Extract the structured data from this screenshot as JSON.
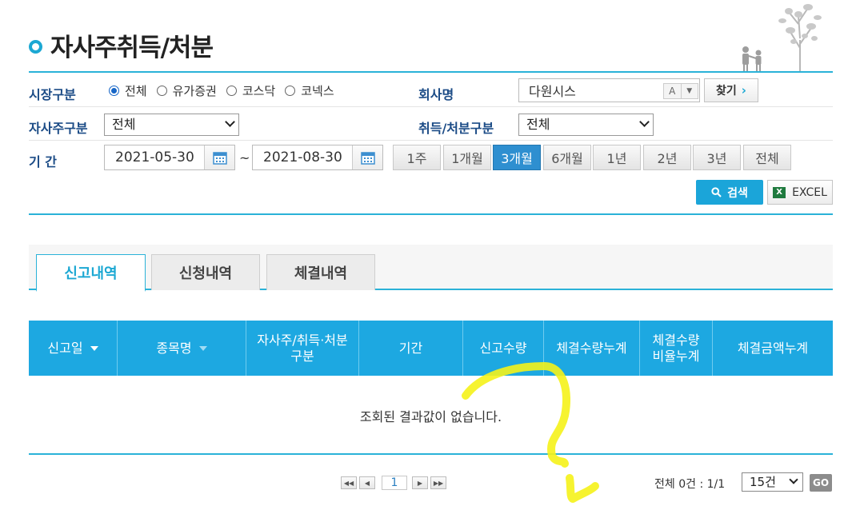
{
  "page": {
    "title": "자사주취득/처분"
  },
  "form": {
    "market_label": "시장구분",
    "market_options": [
      "전체",
      "유가증권",
      "코스닥",
      "코넥스"
    ],
    "market_selected": "전체",
    "company_label": "회사명",
    "company_value": "다원시스",
    "company_a_label": "A",
    "company_arrow": "▼",
    "find_label": "찾기",
    "treasury_label": "자사주구분",
    "treasury_value": "전체",
    "acq_label": "취득/처분구분",
    "acq_value": "전체",
    "period_label": "기 간",
    "date_from": "2021-05-30",
    "date_sep": "~",
    "date_to": "2021-08-30",
    "periods": [
      "1주",
      "1개월",
      "3개월",
      "6개월",
      "1년",
      "2년",
      "3년",
      "전체"
    ],
    "period_selected": "3개월",
    "search_label": "검색",
    "excel_label": "EXCEL",
    "excel_icon_text": "X"
  },
  "tabs": [
    {
      "label": "신고내역",
      "active": true
    },
    {
      "label": "신청내역",
      "active": false
    },
    {
      "label": "체결내역",
      "active": false
    }
  ],
  "table": {
    "headers": [
      "신고일",
      "종목명",
      "자사주/취득·처분\n구분",
      "기간",
      "신고수량",
      "체결수량누계",
      "체결수량\n비율누계",
      "체결금액누계"
    ],
    "empty_message": "조회된 결과값이 없습니다."
  },
  "pagination": {
    "current_page": "1",
    "total_text": "전체 0건 : 1/1",
    "rows_per_page": "15건",
    "go_label": "GO"
  },
  "colors": {
    "accent": "#1ca8d3",
    "table_header": "#1da8e1",
    "active_period": "#2e8fd0",
    "label_text": "#1b4b86",
    "annotation": "#f5f21a"
  }
}
